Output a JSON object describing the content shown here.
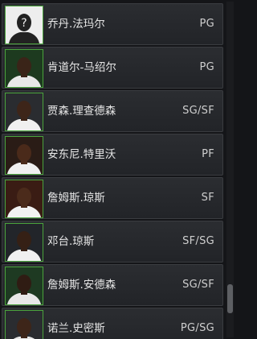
{
  "players": [
    {
      "name": "乔丹.法玛尔",
      "position": "PG",
      "avatar": "unknown-silhouette-icon"
    },
    {
      "name": "肯道尔-马绍尔",
      "position": "PG",
      "avatar": "player-photo"
    },
    {
      "name": "贾森.理查德森",
      "position": "SG/SF",
      "avatar": "player-photo"
    },
    {
      "name": "安东尼.特里沃",
      "position": "PF",
      "avatar": "player-photo"
    },
    {
      "name": "詹姆斯.琼斯",
      "position": "SF",
      "avatar": "player-photo"
    },
    {
      "name": "邓台.琼斯",
      "position": "SF/SG",
      "avatar": "player-photo"
    },
    {
      "name": "詹姆斯.安德森",
      "position": "SG/SF",
      "avatar": "player-photo"
    },
    {
      "name": "诺兰.史密斯",
      "position": "PG/SG",
      "avatar": "player-photo"
    }
  ],
  "scrollbar": {
    "position_fraction": 0.92
  },
  "colors": {
    "row_bg": "#2b2d31",
    "avatar_border": "#4aa33c",
    "text": "#e6e6e6"
  }
}
